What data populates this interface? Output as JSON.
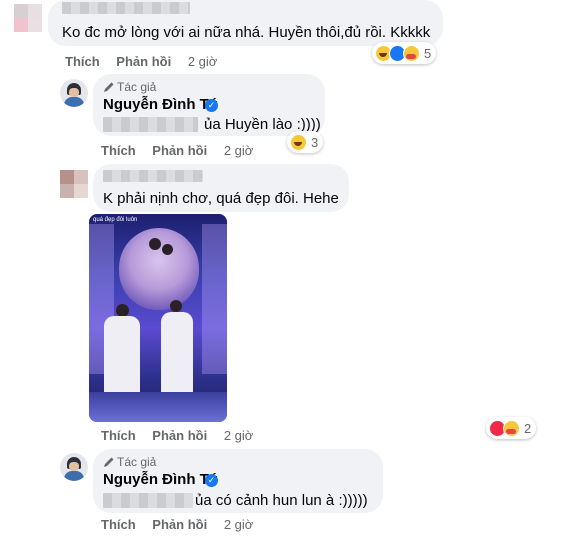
{
  "comments": [
    {
      "text": "Ko đc mở lòng với ai nữa nhá. Huyền thôi,đủ rồi. Kkkkk",
      "actions": {
        "like": "Thích",
        "reply": "Phản hồi",
        "time": "2 giờ"
      },
      "reactions": {
        "icons": [
          "haha-icon",
          "like-icon",
          "care-icon"
        ],
        "count": "5"
      }
    },
    {
      "author_tag": "Tác giả",
      "author": "Nguyễn Đình Tú",
      "text": "ủa Huyền lào :))))",
      "actions": {
        "like": "Thích",
        "reply": "Phản hồi",
        "time": "2 giờ"
      },
      "reactions": {
        "icons": [
          "haha-icon"
        ],
        "count": "3"
      }
    },
    {
      "text": "K phải nịnh chơ, quá đẹp đôi. Hehe",
      "photo_caption": "quá đẹp đôi luôn",
      "actions": {
        "like": "Thích",
        "reply": "Phản hồi",
        "time": "2 giờ"
      },
      "reactions": {
        "icons": [
          "love-icon",
          "care-icon"
        ],
        "count": "2"
      }
    },
    {
      "author_tag": "Tác giả",
      "author": "Nguyễn Đình Tú",
      "text": "ủa có cảnh hun lun à :)))))",
      "actions": {
        "like": "Thích",
        "reply": "Phản hồi",
        "time": "2 giờ"
      }
    }
  ],
  "colors": {
    "bubble": "#f0f2f5",
    "meta": "#65676b",
    "verified": "#1877f2"
  }
}
